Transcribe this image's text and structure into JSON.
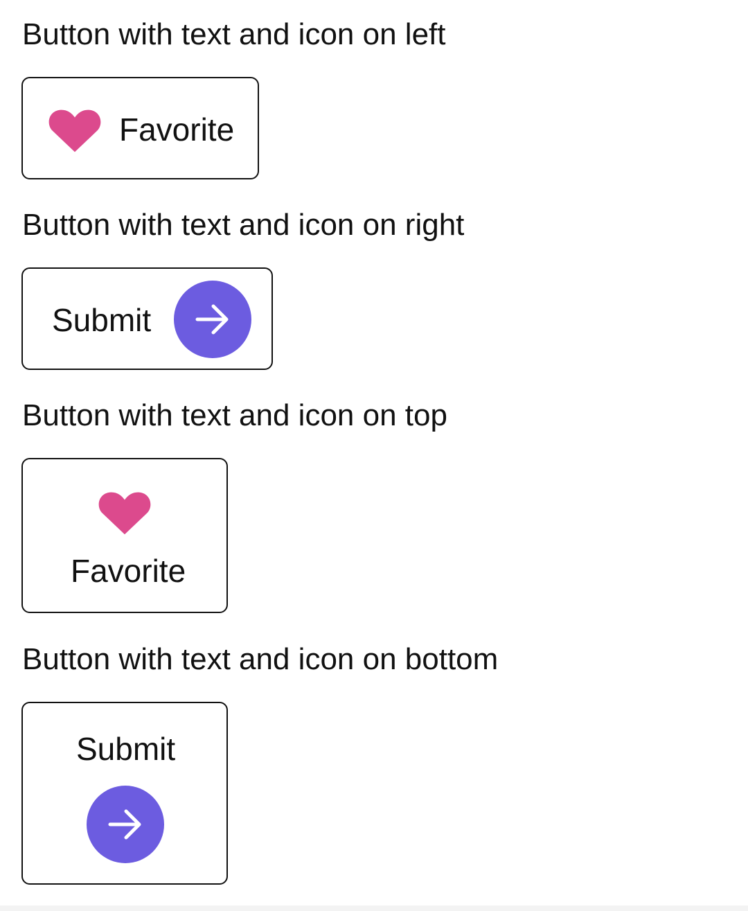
{
  "sections": [
    {
      "label": "Button with text and icon on left",
      "button": {
        "text": "Favorite",
        "icon": "heart-icon",
        "icon_position": "left"
      }
    },
    {
      "label": "Button with text and icon on right",
      "button": {
        "text": "Submit",
        "icon": "arrow-right-circle-icon",
        "icon_position": "right"
      }
    },
    {
      "label": "Button with text and icon on top",
      "button": {
        "text": "Favorite",
        "icon": "heart-icon",
        "icon_position": "top"
      }
    },
    {
      "label": "Button with text and icon on bottom",
      "button": {
        "text": "Submit",
        "icon": "arrow-right-circle-icon",
        "icon_position": "bottom"
      }
    }
  ],
  "colors": {
    "heart": "#dc4a8d",
    "submit_circle": "#6c5ce0",
    "arrow": "#ffffff",
    "border": "#111111",
    "text": "#111111"
  }
}
